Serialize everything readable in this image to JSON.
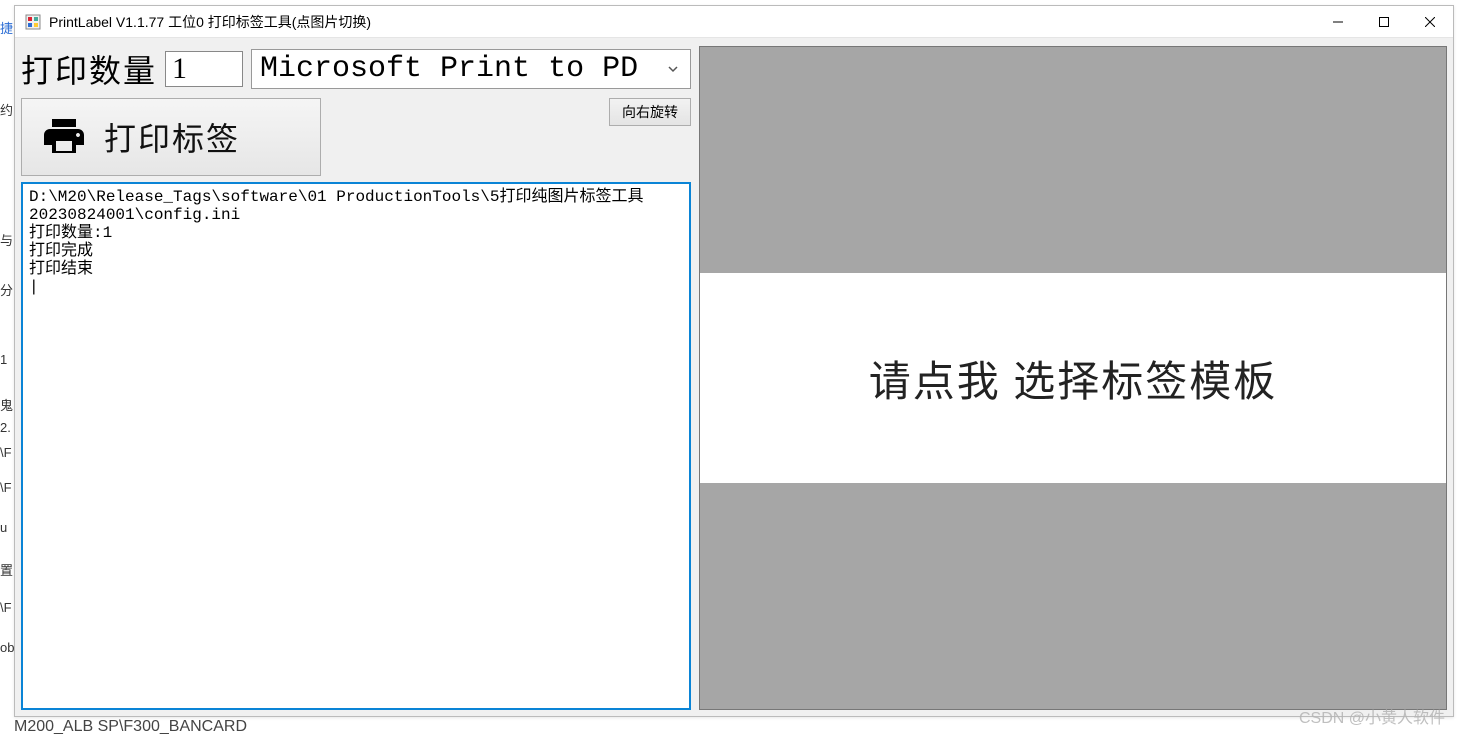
{
  "window": {
    "title": "PrintLabel V1.1.77 工位0 打印标签工具(点图片切换)"
  },
  "controls": {
    "qty_label": "打印数量",
    "qty_value": "1",
    "printer_selected": "Microsoft Print to PD",
    "print_button_label": "打印标签",
    "rotate_button_label": "向右旋转"
  },
  "log_text": "D:\\M20\\Release_Tags\\software\\01 ProductionTools\\5打印纯图片标签工具20230824001\\config.ini\n打印数量:1\n打印完成\n打印结束\n|",
  "template_area": {
    "prompt": "请点我 选择标签模板"
  },
  "watermark": "CSDN @小黄人软件",
  "footer_fragment": "M200_ALB    SP\\F300_BANCARD",
  "bg_fragments": [
    "捷",
    "约",
    "与",
    "分",
    "1",
    "鬼",
    "2.",
    "\\F",
    "\\F",
    "u",
    "置",
    "\\F",
    "ob"
  ]
}
